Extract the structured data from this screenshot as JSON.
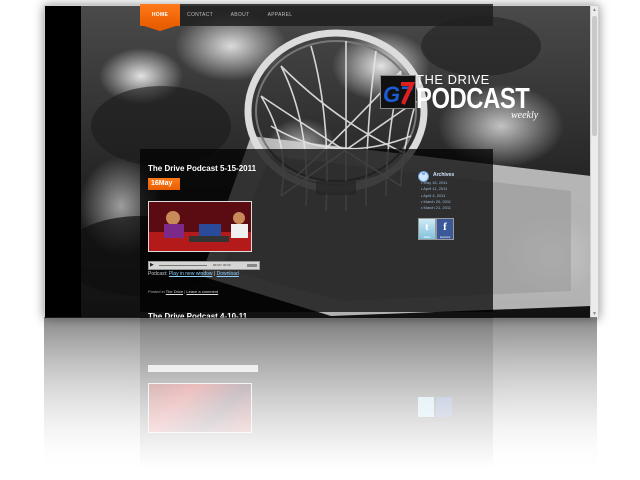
{
  "nav": {
    "items": [
      {
        "label": "HOME",
        "active": true
      },
      {
        "label": "CONTACT",
        "active": false
      },
      {
        "label": "ABOUT",
        "active": false
      },
      {
        "label": "APPAREL",
        "active": false
      }
    ]
  },
  "logo": {
    "mark": "G7",
    "line1": "THE DRIVE",
    "line2": "PODCAST",
    "line3": "weekly"
  },
  "post": {
    "title": "The Drive Podcast 5-15-2011",
    "date_badge": "16May",
    "player_time": "00:00 / 00:00",
    "podcast_prefix": "Podcast:",
    "play_link": "Play in new window",
    "separator": "|",
    "download_link": "Download",
    "posted_prefix": "Posted in",
    "category_link": "The Drive",
    "comment_link": "Leave a comment"
  },
  "sidebar": {
    "archives_title": "Archives",
    "archives": [
      "May 16, 2011",
      "April 11, 2011",
      "April 4, 2011",
      "March 20, 2011",
      "March 21, 2011"
    ],
    "twitter_label": "Twitter",
    "facebook_label": "facebook"
  },
  "post2": {
    "title": "The Drive Podcast 4-10-11"
  },
  "colors": {
    "accent": "#e85d00",
    "link": "#8fd0ff",
    "panel": "#000000"
  }
}
